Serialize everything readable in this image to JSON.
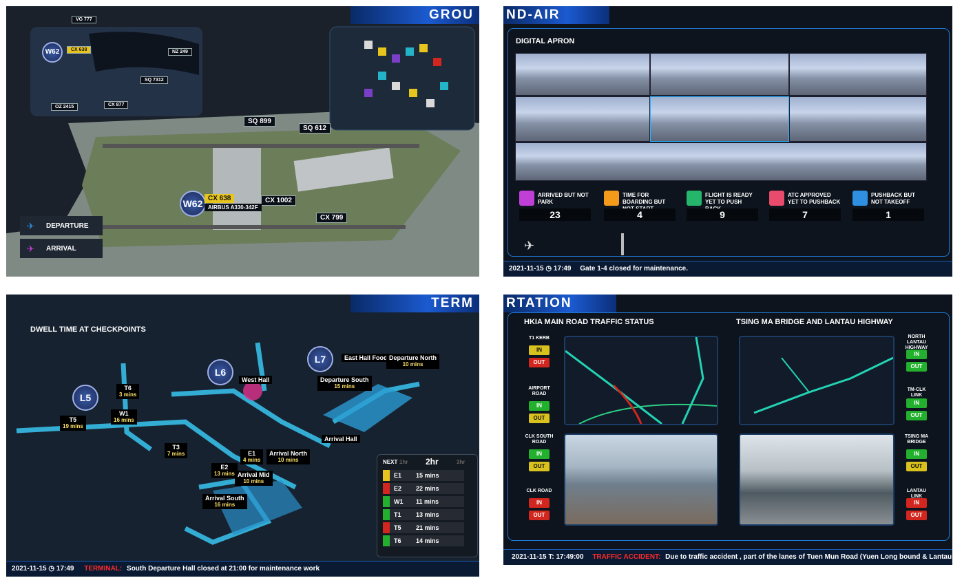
{
  "panel_ground": {
    "banner": "GROU",
    "legend": {
      "departure": "DEPARTURE",
      "arrival": "ARRIVAL"
    },
    "inset_flights": [
      "VG 777",
      "CX 638",
      "NZ 249",
      "SQ 7312",
      "OZ 2415",
      "CX 877"
    ],
    "stand": "W62",
    "selected_flight": "CX 638",
    "selected_flight_sub": "AIRBUS A330-342F",
    "map_flights": [
      "SQ 899",
      "SQ 612",
      "CX 1002",
      "CX 799"
    ]
  },
  "panel_apron": {
    "banner": "ND-AIR",
    "title": "DIGITAL APRON",
    "kpis": [
      {
        "label": "ARRIVED BUT NOT PARK",
        "value": "23",
        "color": "#c03fd6"
      },
      {
        "label": "TIME FOR BOARDING BUT NOT START",
        "value": "4",
        "color": "#f39a1a"
      },
      {
        "label": "FLIGHT IS READY YET TO PUSH BACK",
        "value": "9",
        "color": "#26b66b"
      },
      {
        "label": "ATC APPROVED YET TO PUSHBACK",
        "value": "7",
        "color": "#e84b6b"
      },
      {
        "label": "PUSHBACK BUT NOT TAKEOFF",
        "value": "1",
        "color": "#2f8fe0"
      }
    ],
    "ticker_time": "2021-11-15 ◷ 17:49",
    "ticker_msg": "Gate 1-4 closed for maintenance."
  },
  "panel_terminal": {
    "banner": "TERM",
    "title": "DWELL TIME AT CHECKPOINTS",
    "levels": [
      "L5",
      "L6",
      "L7"
    ],
    "checkpoints": [
      {
        "name": "T5",
        "time": "19 mins"
      },
      {
        "name": "T6",
        "time": "3 mins"
      },
      {
        "name": "W1",
        "time": "16 mins"
      },
      {
        "name": "West Hall",
        "time": ""
      },
      {
        "name": "East Hall Food Court",
        "time": ""
      },
      {
        "name": "Departure North",
        "time": "10 mins"
      },
      {
        "name": "Departure South",
        "time": "15 mins"
      },
      {
        "name": "T3",
        "time": "7 mins"
      },
      {
        "name": "E2",
        "time": "13 mins"
      },
      {
        "name": "E1",
        "time": "4 mins"
      },
      {
        "name": "Arrival North",
        "time": "10 mins"
      },
      {
        "name": "Arrival Mid",
        "time": "10 mins"
      },
      {
        "name": "Arrival South",
        "time": "16 mins"
      },
      {
        "name": "Arrival Hall",
        "time": ""
      }
    ],
    "forecast": {
      "next": "NEXT",
      "tabs": [
        "1hr",
        "2hr",
        "3hr"
      ],
      "active": "2hr",
      "rows": [
        {
          "id": "E1",
          "time": "15 mins",
          "color": "#e8c51e"
        },
        {
          "id": "E2",
          "time": "22 mins",
          "color": "#d2261e"
        },
        {
          "id": "W1",
          "time": "11 mins",
          "color": "#23b02e"
        },
        {
          "id": "T1",
          "time": "13 mins",
          "color": "#23b02e"
        },
        {
          "id": "T5",
          "time": "21 mins",
          "color": "#d2261e"
        },
        {
          "id": "T6",
          "time": "14 mins",
          "color": "#23b02e"
        }
      ]
    },
    "ticker_time": "2021-11-15 ◷ 17:49",
    "ticker_tag": "TERMINAL:",
    "ticker_msg": "South Departure Hall closed at 21:00 for maintenance work"
  },
  "panel_transport": {
    "banner": "RTATION",
    "title_left": "HKIA MAIN ROAD TRAFFIC STATUS",
    "title_right": "TSING MA BRIDGE AND LANTAU HIGHWAY",
    "roads_left": [
      {
        "name": "T1 KERB",
        "in": "IN",
        "out": "OUT",
        "in_color": "#d9c21e",
        "out_color": "#d2261e"
      },
      {
        "name": "AIRPORT ROAD",
        "in": "IN",
        "out": "OUT",
        "in_color": "#23b02e",
        "out_color": "#d9c21e"
      },
      {
        "name": "CLK SOUTH ROAD",
        "in": "IN",
        "out": "OUT",
        "in_color": "#23b02e",
        "out_color": "#d9c21e"
      },
      {
        "name": "CLK ROAD",
        "in": "IN",
        "out": "OUT",
        "in_color": "#d2261e",
        "out_color": "#d2261e"
      }
    ],
    "roads_right": [
      {
        "name": "NORTH LANTAU HIGHWAY",
        "in": "IN",
        "out": "OUT",
        "in_color": "#23b02e",
        "out_color": "#23b02e"
      },
      {
        "name": "TM-CLK LINK",
        "in": "IN",
        "out": "OUT",
        "in_color": "#23b02e",
        "out_color": "#23b02e"
      },
      {
        "name": "TSING MA BRIDGE",
        "in": "IN",
        "out": "OUT",
        "in_color": "#23b02e",
        "out_color": "#d9c21e"
      },
      {
        "name": "LANTAU LINK",
        "in": "IN",
        "out": "OUT",
        "in_color": "#d2261e",
        "out_color": "#d2261e"
      }
    ],
    "ticker_time": "2021-11-15 T: 17:49:00",
    "ticker_tag": "TRAFFIC ACCIDENT:",
    "ticker_msg": "Due to traffic accident , part of the lanes of Tuen Mun Road (Yuen Long bound & Lantau link)..."
  }
}
